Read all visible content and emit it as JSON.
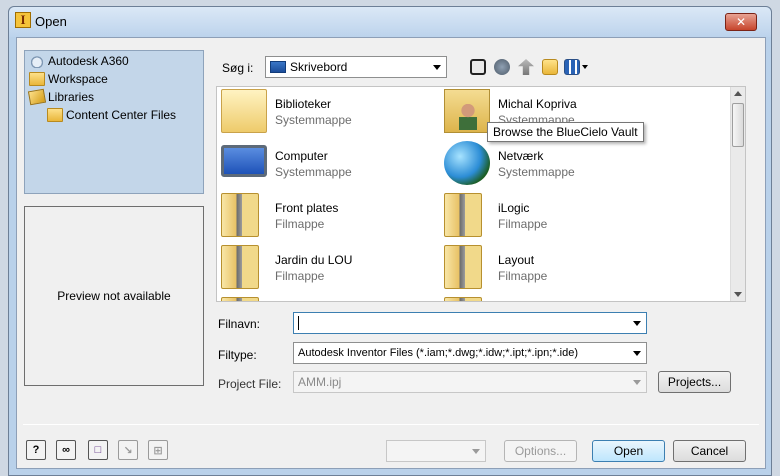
{
  "window": {
    "title": "Open",
    "close_symbol": "✕",
    "app_glyph": "I"
  },
  "nav": {
    "items": [
      {
        "label": "Autodesk A360",
        "icon": "cloud-icon"
      },
      {
        "label": "Workspace",
        "icon": "folder-icon"
      },
      {
        "label": "Libraries",
        "icon": "library-icon"
      },
      {
        "label": "Content Center Files",
        "icon": "folder-icon"
      }
    ]
  },
  "preview": {
    "text": "Preview not available"
  },
  "look_in": {
    "label": "Søg i:",
    "value": "Skrivebord"
  },
  "tooltip": {
    "text": "Browse the BlueCielo Vault"
  },
  "files": [
    {
      "name": "Biblioteker",
      "type": "Systemmappe",
      "icon": "libraries-icon"
    },
    {
      "name": "Michal Kopriva",
      "type": "Systemmappe",
      "icon": "user-folder-icon"
    },
    {
      "name": "Computer",
      "type": "Systemmappe",
      "icon": "computer-icon"
    },
    {
      "name": "Netværk",
      "type": "Systemmappe",
      "icon": "network-icon"
    },
    {
      "name": "Front plates",
      "type": "Filmappe",
      "icon": "file-folder-icon"
    },
    {
      "name": "iLogic",
      "type": "Filmappe",
      "icon": "file-folder-icon"
    },
    {
      "name": "Jardin du LOU",
      "type": "Filmappe",
      "icon": "file-folder-icon"
    },
    {
      "name": "Layout",
      "type": "Filmappe",
      "icon": "file-folder-icon"
    }
  ],
  "filename": {
    "label": "Filnavn:",
    "value": ""
  },
  "filetype": {
    "label": "Filtype:",
    "value": "Autodesk Inventor Files (*.iam;*.dwg;*.idw;*.ipt;*.ipn;*.ide)"
  },
  "project": {
    "label": "Project File:",
    "value": "AMM.ipj",
    "button": "Projects..."
  },
  "buttons": {
    "options": "Options...",
    "open": "Open",
    "cancel": "Cancel"
  },
  "bottom_icons": [
    {
      "name": "help-icon",
      "glyph": "?"
    },
    {
      "name": "find-icon",
      "glyph": "∞"
    },
    {
      "name": "vault-icon",
      "glyph": "□"
    },
    {
      "name": "checkout-icon",
      "glyph": "↘"
    },
    {
      "name": "refresh-icon",
      "glyph": "⊞"
    }
  ]
}
